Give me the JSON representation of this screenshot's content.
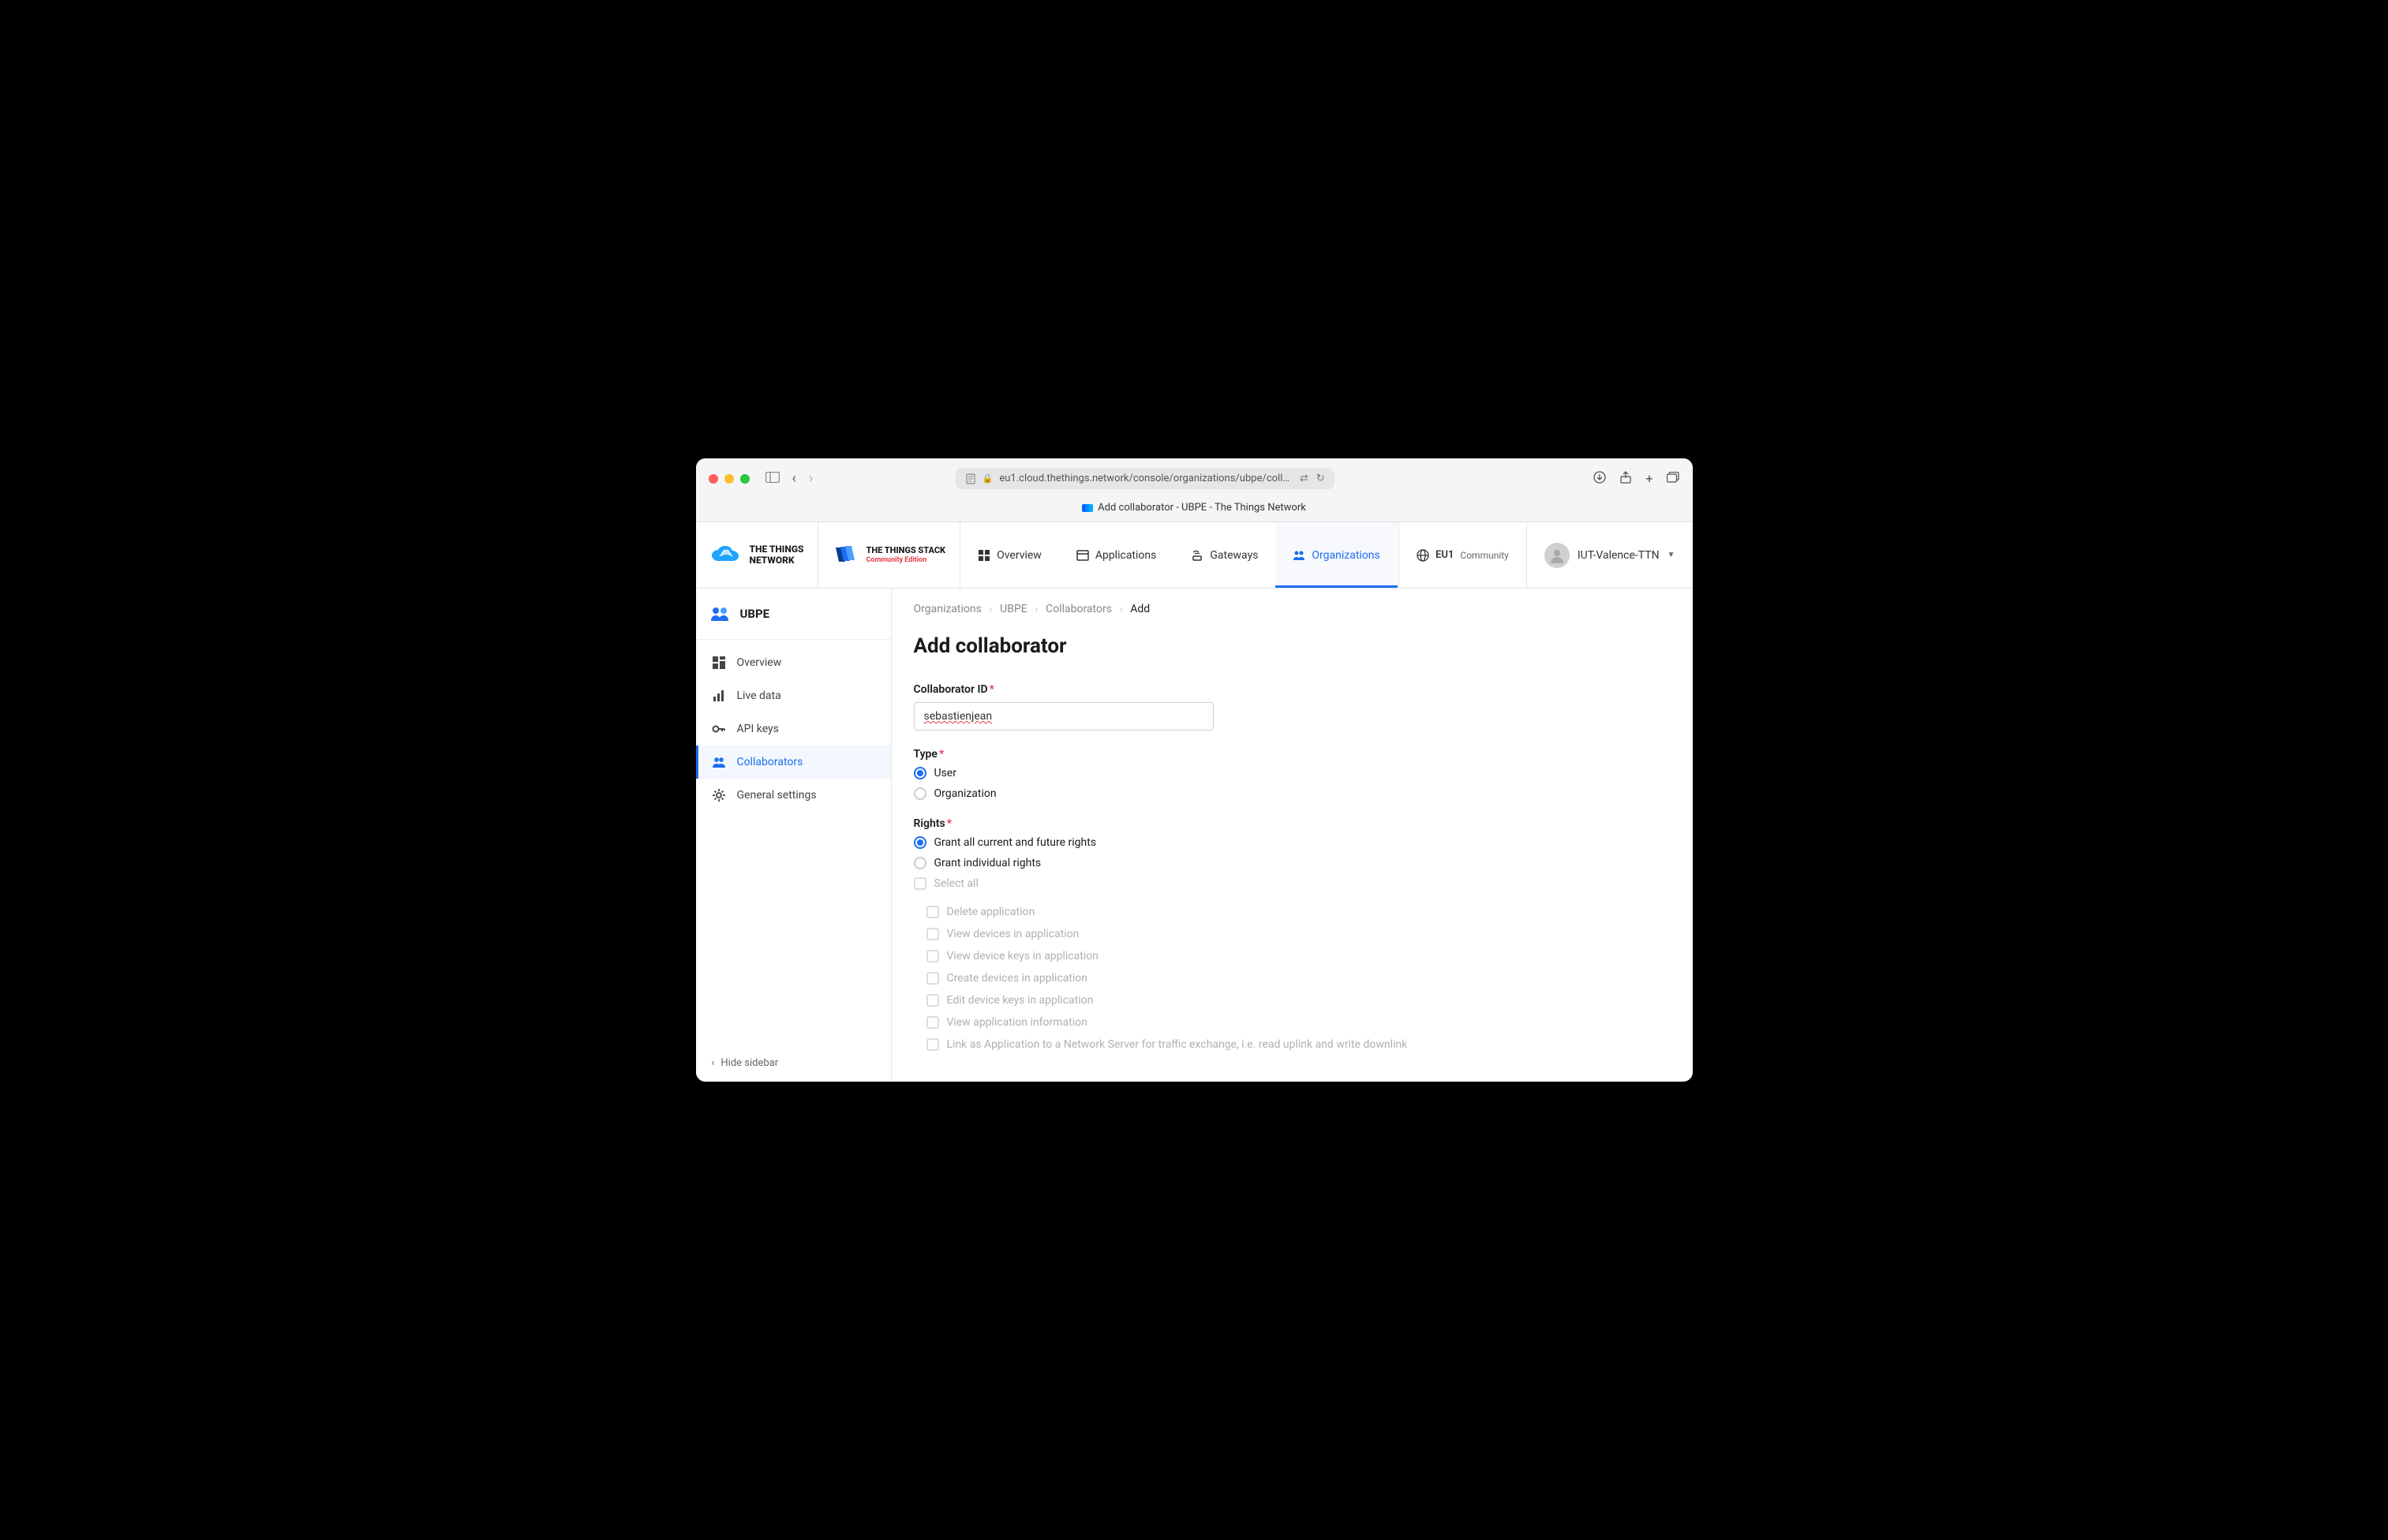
{
  "browser": {
    "url": "eu1.cloud.thethings.network/console/organizations/ubpe/collaborators/ac",
    "tab_title": "Add collaborator - UBPE - The Things Network"
  },
  "brand": {
    "network_line1": "THE THINGS",
    "network_line2": "NETWORK",
    "stack_line1": "THE THINGS STACK",
    "stack_line2": "Community Edition"
  },
  "topnav": {
    "overview": "Overview",
    "applications": "Applications",
    "gateways": "Gateways",
    "organizations": "Organizations"
  },
  "cluster": {
    "name": "EU1",
    "sub": "Community"
  },
  "user": {
    "name": "IUT-Valence-TTN"
  },
  "sidebar": {
    "org_name": "UBPE",
    "items": {
      "overview": "Overview",
      "live_data": "Live data",
      "api_keys": "API keys",
      "collaborators": "Collaborators",
      "general_settings": "General settings"
    },
    "hide": "Hide sidebar"
  },
  "breadcrumb": {
    "organizations": "Organizations",
    "org": "UBPE",
    "collaborators": "Collaborators",
    "add": "Add"
  },
  "page": {
    "title": "Add collaborator",
    "collaborator_id_label": "Collaborator ID",
    "collaborator_id_value": "sebastienjean",
    "type_label": "Type",
    "type_user": "User",
    "type_organization": "Organization",
    "rights_label": "Rights",
    "rights_all": "Grant all current and future rights",
    "rights_individual": "Grant individual rights",
    "select_all": "Select all",
    "rights_list": [
      "Delete application",
      "View devices in application",
      "View device keys in application",
      "Create devices in application",
      "Edit device keys in application",
      "View application information",
      "Link as Application to a Network Server for traffic exchange, i.e. read uplink and write downlink"
    ]
  }
}
